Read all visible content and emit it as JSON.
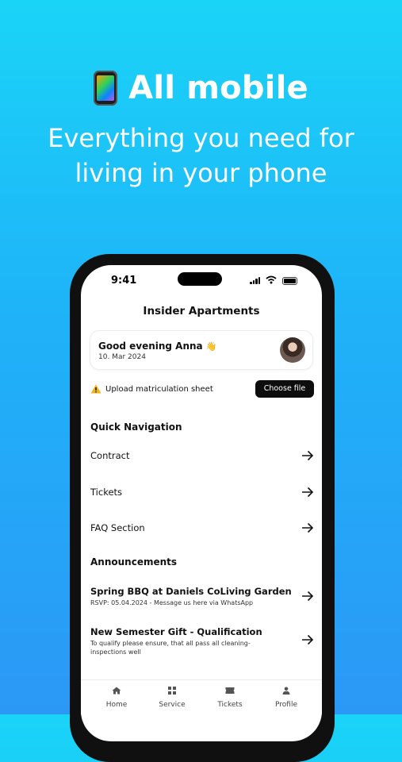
{
  "hero": {
    "title": "All mobile",
    "subtitle_line1": "Everything you need for",
    "subtitle_line2": "living in your phone"
  },
  "status_bar": {
    "time": "9:41"
  },
  "app": {
    "title": "Insider Apartments"
  },
  "greeting": {
    "text": "Good evening Anna",
    "emoji": "👋",
    "date": "10. Mar 2024"
  },
  "upload": {
    "text": "Upload matriculation sheet",
    "button_label": "Choose file"
  },
  "quick_navigation": {
    "heading": "Quick Navigation",
    "items": [
      {
        "label": "Contract"
      },
      {
        "label": "Tickets"
      },
      {
        "label": "FAQ Section"
      }
    ]
  },
  "announcements": {
    "heading": "Announcements",
    "items": [
      {
        "title": "Spring BBQ at Daniels CoLiving Garden",
        "subtitle": "RSVP: 05.04.2024 - Message us here via WhatsApp"
      },
      {
        "title": "New Semester Gift - Qualification",
        "subtitle": "To qualify please ensure, that all pass all cleaning-inspections well"
      }
    ]
  },
  "tabbar": {
    "items": [
      {
        "label": "Home",
        "icon": "home-icon"
      },
      {
        "label": "Service",
        "icon": "grid-icon"
      },
      {
        "label": "Tickets",
        "icon": "ticket-icon"
      },
      {
        "label": "Profile",
        "icon": "person-icon"
      }
    ]
  },
  "colors": {
    "background_top": "#1ad4f7",
    "background_bottom": "#2b98f6",
    "button": "#0d0d0d",
    "warning": "#f2b418"
  }
}
